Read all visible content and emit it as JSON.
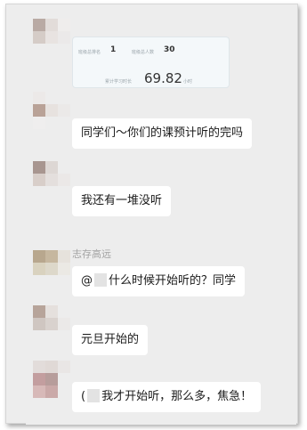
{
  "stats_card": {
    "rank_label": "班级总排名",
    "rank_value": "1",
    "class_size_label": "班级总人数",
    "class_size_value": "30",
    "study_time_label": "累计学习时长",
    "study_time_value": "69.82",
    "study_time_unit": "小时"
  },
  "messages": [
    {
      "text": "同学们～你们的课预计听的完吗"
    },
    {
      "text": "我还有一堆没听"
    },
    {
      "sender": "志存高远",
      "prefix": "@",
      "text": "什么时候开始听的？同学"
    },
    {
      "text": "元旦开始的"
    },
    {
      "prefix": "(",
      "text": "我才开始听，那么多，焦急！"
    }
  ],
  "colors": {
    "background": "#ededed",
    "bubble": "#ffffff",
    "text": "#1a1a1a",
    "name": "#a3a3a3"
  }
}
